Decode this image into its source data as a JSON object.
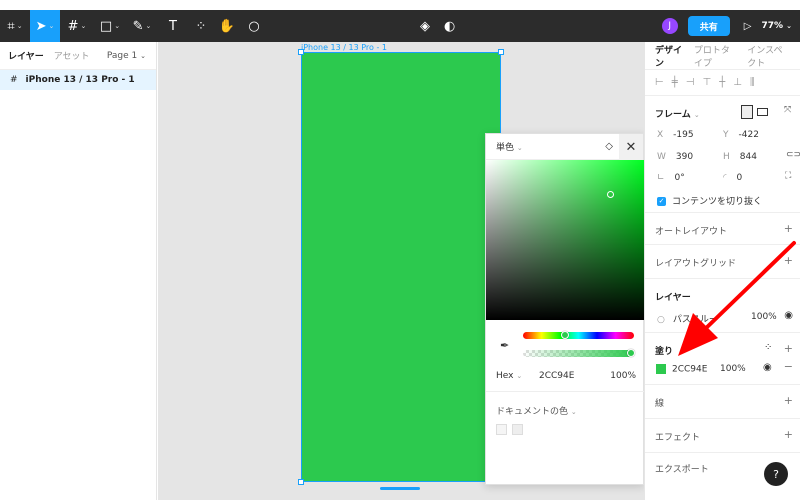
{
  "toolbar": {
    "zoom": "77%",
    "share_label": "共有",
    "avatar_initial": "J"
  },
  "left_panel": {
    "tab_layers": "レイヤー",
    "tab_assets": "アセット",
    "page_selector": "Page 1",
    "layers": [
      {
        "name": "iPhone 13 / 13 Pro - 1"
      }
    ]
  },
  "canvas": {
    "frame_label": "iPhone 13 / 13 Pro - 1",
    "frame_fill": "#2CC94E",
    "selection_color": "#18A0FB"
  },
  "color_picker": {
    "fill_type": "単色",
    "mode": "Hex",
    "hex_value": "2CC94E",
    "opacity": "100%",
    "document_colors_label": "ドキュメントの色"
  },
  "right_panel": {
    "tab_design": "デザイン",
    "tab_prototype": "プロトタイプ",
    "tab_inspect": "インスペクト",
    "frame": {
      "title": "フレーム",
      "x_label": "X",
      "x": "-195",
      "y_label": "Y",
      "y": "-422",
      "w_label": "W",
      "w": "390",
      "h_label": "H",
      "h": "844",
      "rotation": "0°",
      "radius": "0",
      "clip_content_label": "コンテンツを切り抜く"
    },
    "auto_layout": "オートレイアウト",
    "layout_grid": "レイアウトグリッド",
    "layer": {
      "title": "レイヤー",
      "blend": "パススルー",
      "opacity": "100%"
    },
    "fill": {
      "title": "塗り",
      "hex": "2CC94E",
      "opacity": "100%",
      "color": "#2CC94E"
    },
    "stroke": "線",
    "effects": "エフェクト",
    "export": "エクスポート",
    "help": "?"
  },
  "annotation": {
    "arrow_color": "#FF0000"
  }
}
